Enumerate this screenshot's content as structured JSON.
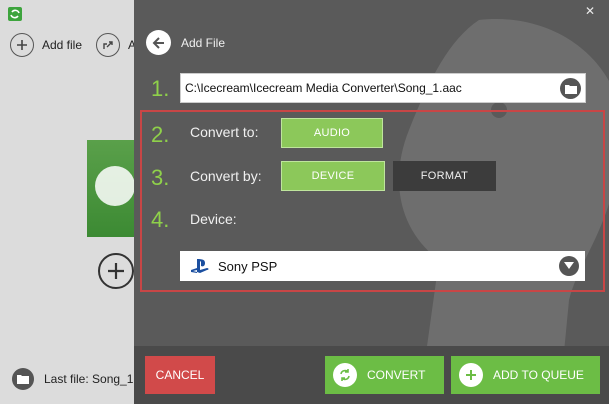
{
  "background_app": {
    "add_file_label": "Add file",
    "second_action_label": "A",
    "last_file_label": "Last file: Song_1."
  },
  "panel": {
    "back_label": "Add File",
    "close_glyph": "✕",
    "steps": [
      "1.",
      "2.",
      "3.",
      "4."
    ],
    "file_path": "C:\\Icecream\\Icecream Media Converter\\Song_1.aac",
    "convert_to": {
      "label": "Convert to:",
      "selected": "AUDIO"
    },
    "convert_by": {
      "label": "Convert by:",
      "options": [
        "DEVICE",
        "FORMAT"
      ],
      "selected": "DEVICE"
    },
    "device": {
      "label": "Device:",
      "selected": "Sony PSP"
    },
    "buttons": {
      "cancel": "CANCEL",
      "convert": "CONVERT",
      "add_to_queue": "ADD TO QUEUE"
    }
  },
  "colors": {
    "accent_green": "#8cc85a",
    "step_green": "#8fd14a",
    "cancel_red": "#d14a4a",
    "highlight_red": "#c84646",
    "panel_bg": "#5a5a5a"
  },
  "icons": {
    "app_logo": "app-logo-icon",
    "add": "plus-circle-icon",
    "share": "share-icon",
    "back": "arrow-left-icon",
    "browse": "folder-icon",
    "playstation": "playstation-icon",
    "dropdown": "chevron-down-icon",
    "convert": "refresh-icon",
    "queue": "plus-icon"
  }
}
